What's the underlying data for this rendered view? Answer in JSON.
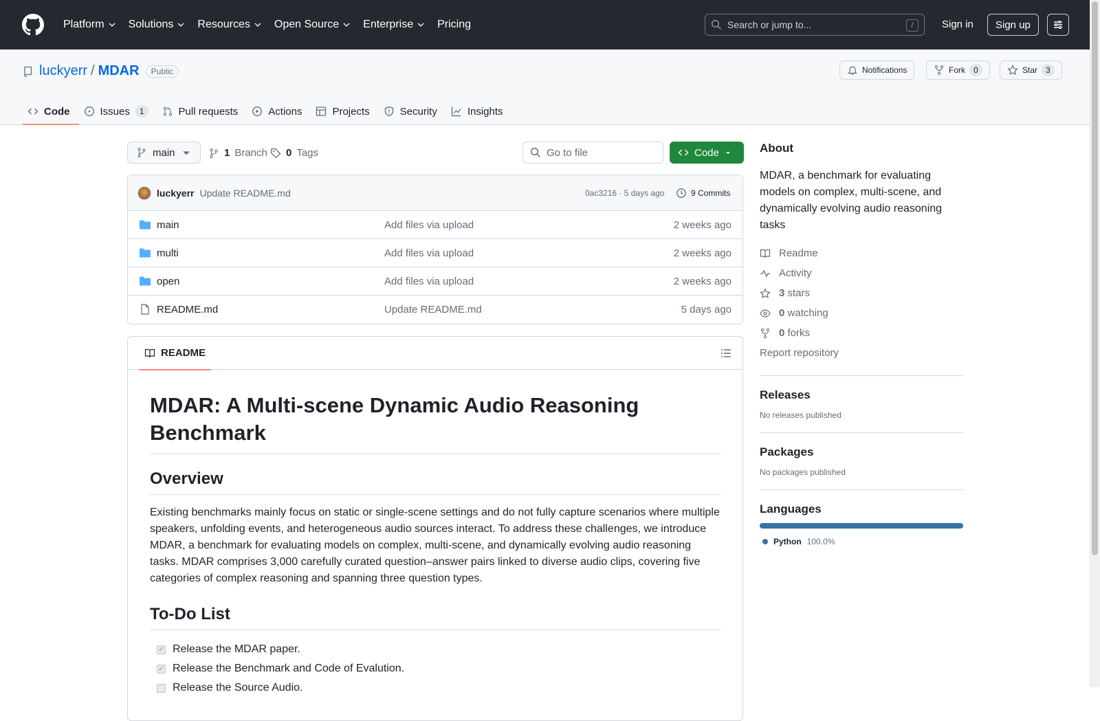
{
  "header": {
    "nav": [
      "Platform",
      "Solutions",
      "Resources",
      "Open Source",
      "Enterprise",
      "Pricing"
    ],
    "search_placeholder": "Search or jump to...",
    "search_shortcut": "/",
    "signin": "Sign in",
    "signup": "Sign up"
  },
  "repo": {
    "owner": "luckyerr",
    "separator": "/",
    "name": "MDAR",
    "visibility": "Public",
    "notifications": "Notifications",
    "fork_label": "Fork",
    "fork_count": "0",
    "star_label": "Star",
    "star_count": "3"
  },
  "tabs": [
    {
      "label": "Code",
      "icon": "code-icon",
      "active": true
    },
    {
      "label": "Issues",
      "icon": "issue-icon",
      "count": "1"
    },
    {
      "label": "Pull requests",
      "icon": "pull-request-icon"
    },
    {
      "label": "Actions",
      "icon": "play-icon"
    },
    {
      "label": "Projects",
      "icon": "table-icon"
    },
    {
      "label": "Security",
      "icon": "shield-icon"
    },
    {
      "label": "Insights",
      "icon": "graph-icon"
    }
  ],
  "branchbar": {
    "branch": "main",
    "branch_count": "1",
    "branch_label": "Branch",
    "tag_count": "0",
    "tag_label": "Tags",
    "goto_placeholder": "Go to file",
    "code_button": "Code"
  },
  "commit": {
    "author": "luckyerr",
    "message": "Update README.md",
    "hash_time": "0ac3216 · 5 days ago",
    "commits": "9 Commits"
  },
  "files": [
    {
      "name": "main",
      "type": "folder",
      "message": "Add files via upload",
      "date": "2 weeks ago"
    },
    {
      "name": "multi",
      "type": "folder",
      "message": "Add files via upload",
      "date": "2 weeks ago"
    },
    {
      "name": "open",
      "type": "folder",
      "message": "Add files via upload",
      "date": "2 weeks ago"
    },
    {
      "name": "README.md",
      "type": "file",
      "message": "Update README.md",
      "date": "5 days ago"
    }
  ],
  "readme": {
    "tab": "README",
    "title": "MDAR: A Multi-scene Dynamic Audio Reasoning Benchmark",
    "overview_heading": "Overview",
    "overview_text": "Existing benchmarks mainly focus on static or single-scene settings and do not fully capture scenarios where multiple speakers, unfolding events, and heterogeneous audio sources interact. To address these challenges, we introduce MDAR, a benchmark for evaluating models on complex, multi-scene, and dynamically evolving audio reasoning tasks. MDAR comprises 3,000 carefully curated question–answer pairs linked to diverse audio clips, covering five categories of complex reasoning and spanning three question types.",
    "todo_heading": "To-Do List",
    "todo": [
      {
        "text": "Release the MDAR paper.",
        "checked": true
      },
      {
        "text": "Release the Benchmark and Code of Evalution.",
        "checked": true
      },
      {
        "text": "Release the Source Audio.",
        "checked": false
      }
    ]
  },
  "sidebar": {
    "about_heading": "About",
    "about_text": "MDAR, a benchmark for evaluating models on complex, multi-scene, and dynamically evolving audio reasoning tasks",
    "readme": "Readme",
    "activity": "Activity",
    "stars_count": "3",
    "stars_label": "stars",
    "watching_count": "0",
    "watching_label": "watching",
    "forks_count": "0",
    "forks_label": "forks",
    "report": "Report repository",
    "releases_heading": "Releases",
    "releases_text": "No releases published",
    "packages_heading": "Packages",
    "packages_text": "No packages published",
    "languages_heading": "Languages",
    "language_name": "Python",
    "language_pct": "100.0%",
    "language_color": "#3572a5"
  }
}
